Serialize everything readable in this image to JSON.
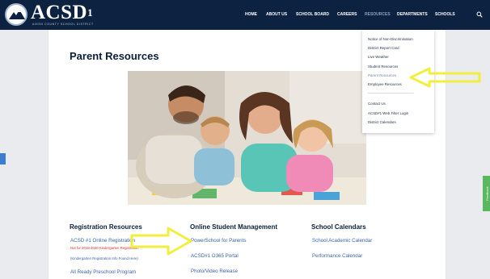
{
  "logo": {
    "text": "ACSD",
    "superscript": "1",
    "subtitle": "AIKEN COUNTY SCHOOL DISTRICT"
  },
  "nav": {
    "items": [
      {
        "label": "HOME"
      },
      {
        "label": "ABOUT US"
      },
      {
        "label": "SCHOOL BOARD"
      },
      {
        "label": "CAREERS"
      },
      {
        "label": "RESOURCES"
      },
      {
        "label": "DEPARTMENTS"
      },
      {
        "label": "SCHOOLS"
      }
    ],
    "active": "RESOURCES",
    "search_icon": "search-icon"
  },
  "dropdown": {
    "items": [
      {
        "label": "Notice of Non-Discrimination"
      },
      {
        "label": "District Report Card"
      },
      {
        "label": "Live Weather"
      },
      {
        "label": "Student Resources"
      },
      {
        "label": "Parent Resources"
      },
      {
        "label": "Employee Resources"
      },
      {
        "label": "—————————————"
      },
      {
        "label": "Contact Us"
      },
      {
        "label": "ACSD#1 Web Filter Login"
      },
      {
        "label": "District Calendars"
      }
    ],
    "current": "Parent Resources"
  },
  "page": {
    "title": "Parent Resources"
  },
  "sections": {
    "registration": {
      "title": "Registration Resources",
      "link1": "ACSD #1 Online Registration",
      "note_red": "Not for 2019-2020 Kindergarten Registration",
      "note_blue": "(Kindergarten Registration Info Found Here)",
      "link2": "All Ready Preschool Program"
    },
    "online": {
      "title": "Online Student Management",
      "link1": "PowerSchool for Parents",
      "link2": "ACSD#1 O365 Portal",
      "link3": "Photo/Video Release"
    },
    "calendars": {
      "title": "School Calendars",
      "link1": "School Academic Calendar",
      "link2": "Performance Calendar"
    }
  },
  "feedback": {
    "label": "Feedback"
  },
  "colors": {
    "navbar": "#0c2240",
    "link": "#3d63a6",
    "heading": "#0b1f38",
    "highlight_arrow": "#f2ee3d",
    "note_red": "#d42b2b",
    "feedback_tab": "#5bb860",
    "page_background": "#e9ebee"
  }
}
